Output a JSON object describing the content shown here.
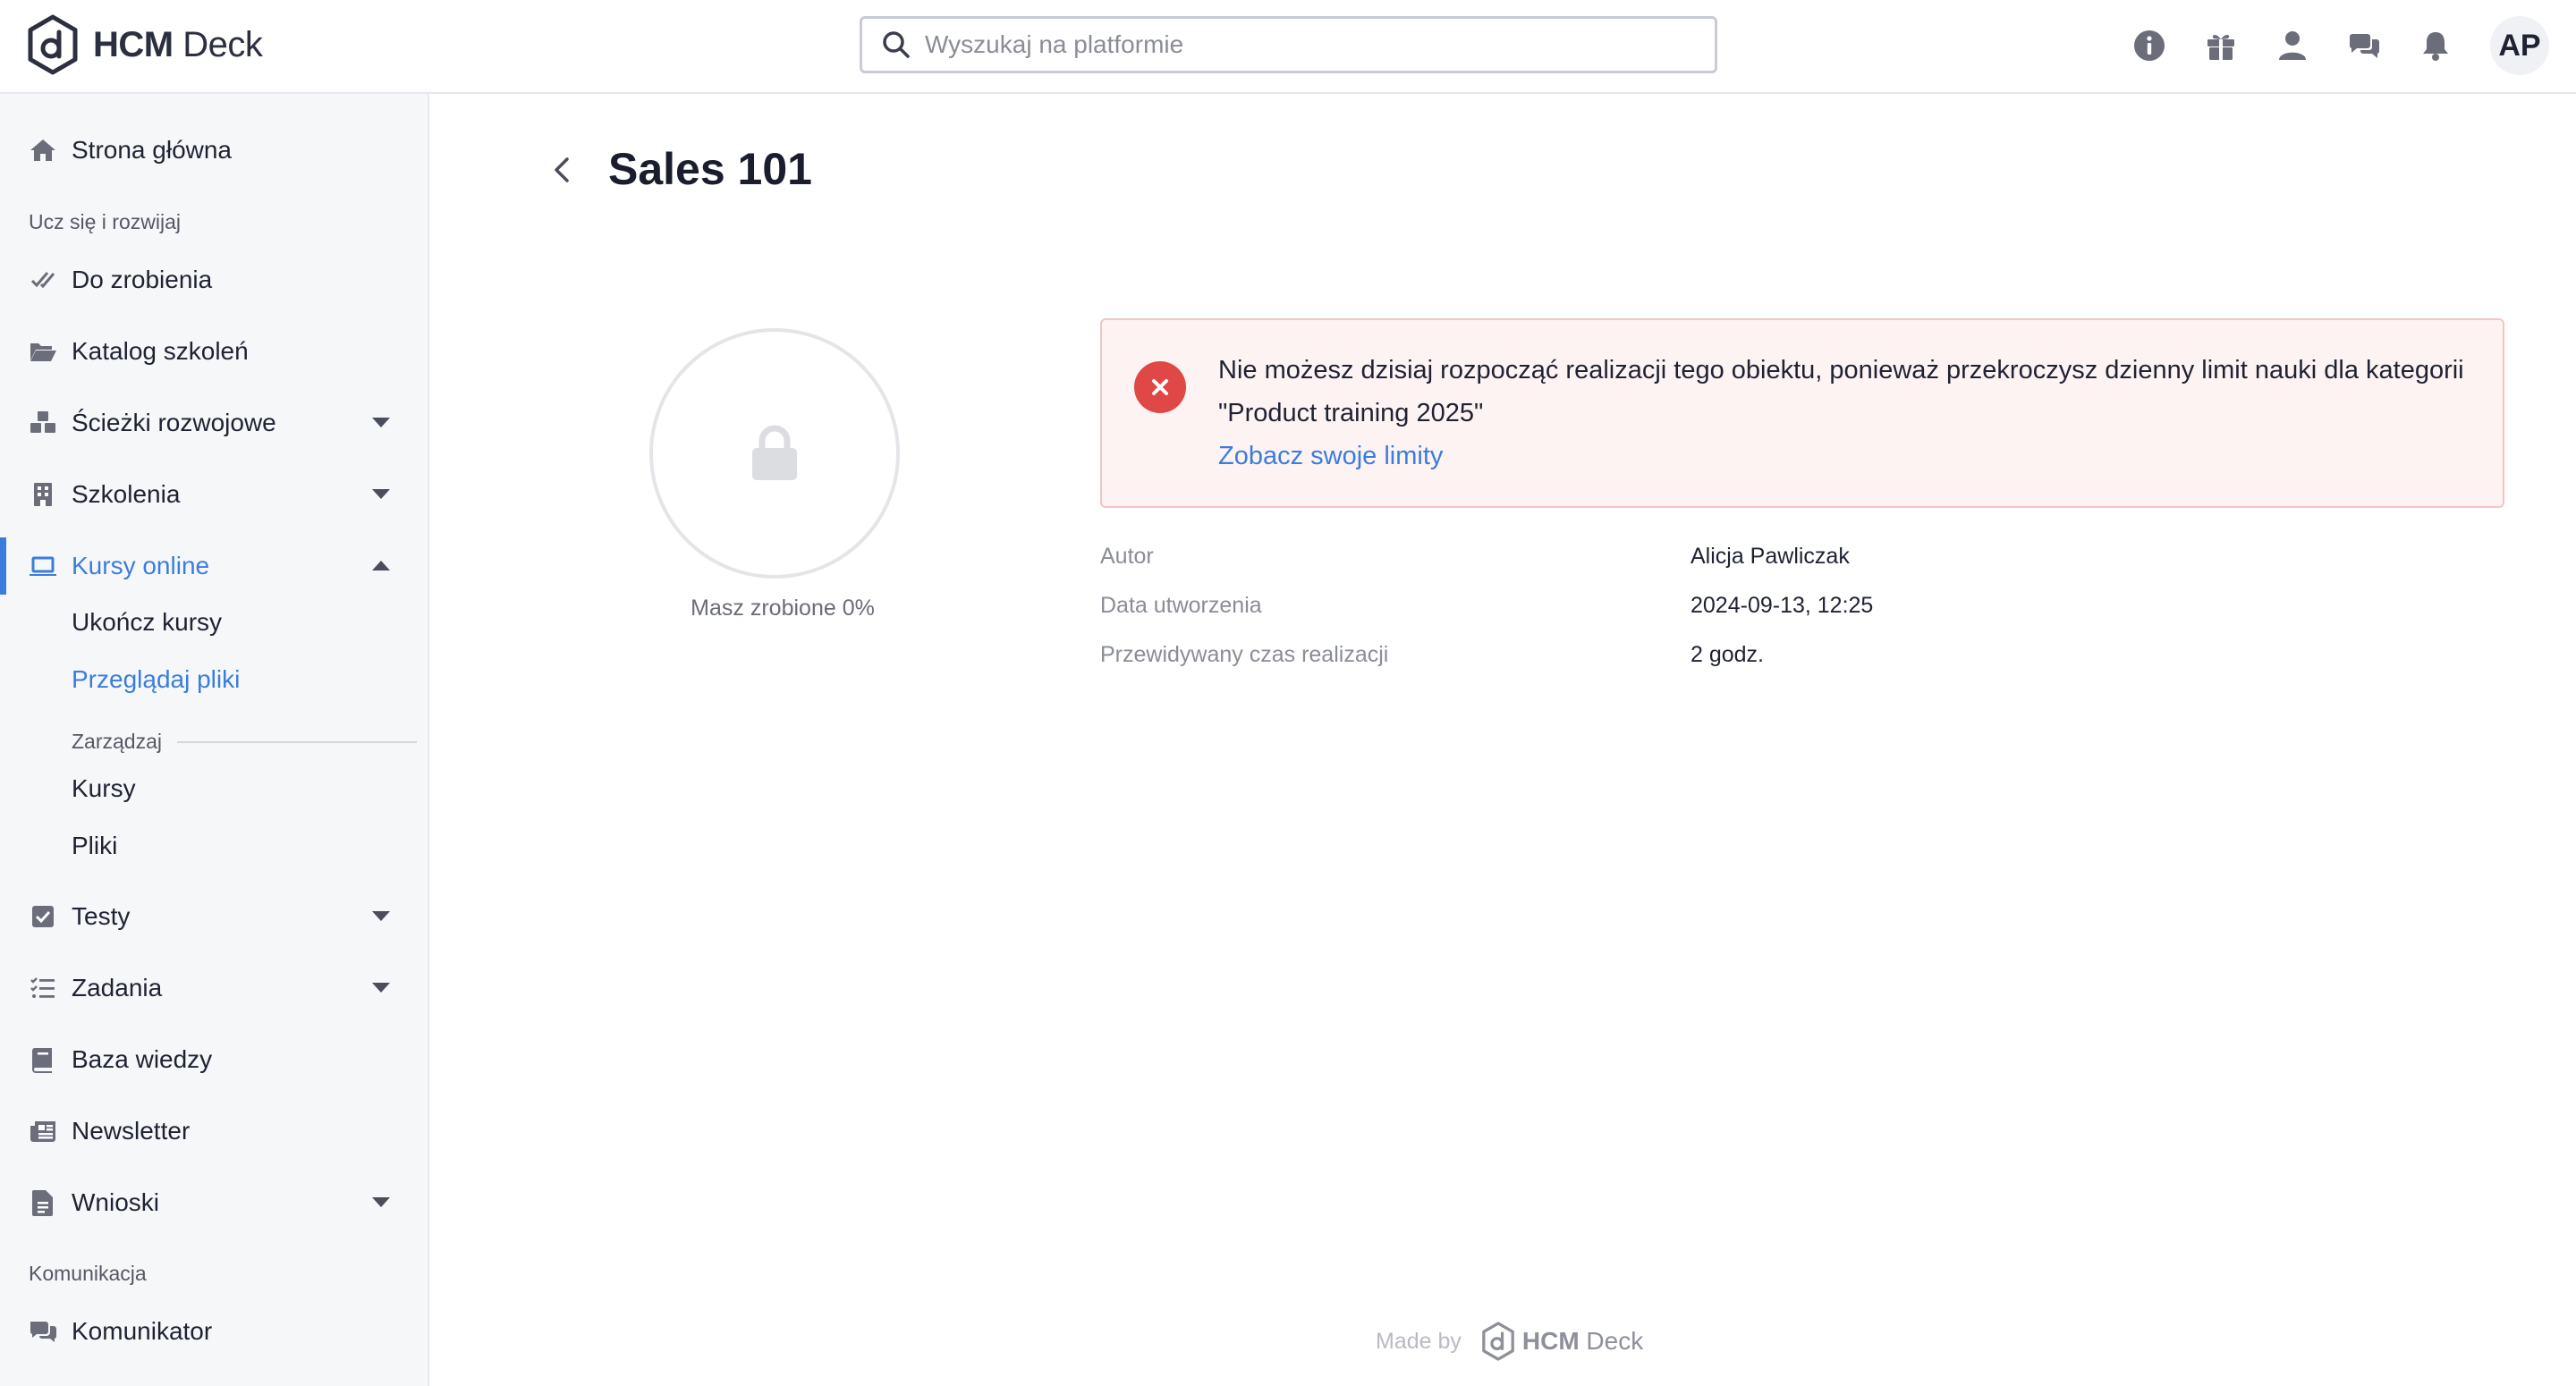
{
  "header": {
    "logo_bold": "HCM",
    "logo_light": " Deck",
    "search_placeholder": "Wyszukaj na platformie",
    "avatar_initials": "AP",
    "icons": [
      "info-icon",
      "gift-icon",
      "user-icon",
      "chat-icon",
      "bell-icon"
    ]
  },
  "sidebar": {
    "home": "Strona główna",
    "section_learn": "Ucz się i rozwijaj",
    "todo": "Do zrobienia",
    "catalog": "Katalog szkoleń",
    "paths": "Ścieżki rozwojowe",
    "trainings": "Szkolenia",
    "online_courses": "Kursy online",
    "finish_courses": "Ukończ kursy",
    "browse_files": "Przeglądaj pliki",
    "manage": "Zarządzaj",
    "courses": "Kursy",
    "files": "Pliki",
    "tests": "Testy",
    "tasks": "Zadania",
    "knowledge_base": "Baza wiedzy",
    "newsletter": "Newsletter",
    "requests": "Wnioski",
    "section_comm": "Komunikacja",
    "messenger": "Komunikator"
  },
  "main": {
    "title": "Sales 101",
    "progress_text": "Masz zrobione 0%",
    "progress_percent": 0,
    "alert_message": "Nie możesz dzisiaj rozpocząć realizacji tego obiektu, ponieważ przekroczysz dzienny limit nauki dla kategorii \"Product training 2025\"",
    "alert_link": "Zobacz swoje limity",
    "meta": {
      "author_label": "Autor",
      "author_value": "Alicja Pawliczak",
      "created_label": "Data utworzenia",
      "created_value": "2024-09-13, 12:25",
      "duration_label": "Przewidywany czas realizacji",
      "duration_value": "2 godz."
    }
  },
  "footer": {
    "made_by": "Made by",
    "logo_bold": "HCM",
    "logo_light": " Deck"
  },
  "colors": {
    "accent": "#3b7ddd",
    "alert_bg": "#fdf3f3",
    "alert_border": "#f3c4c6",
    "error": "#e04747"
  }
}
